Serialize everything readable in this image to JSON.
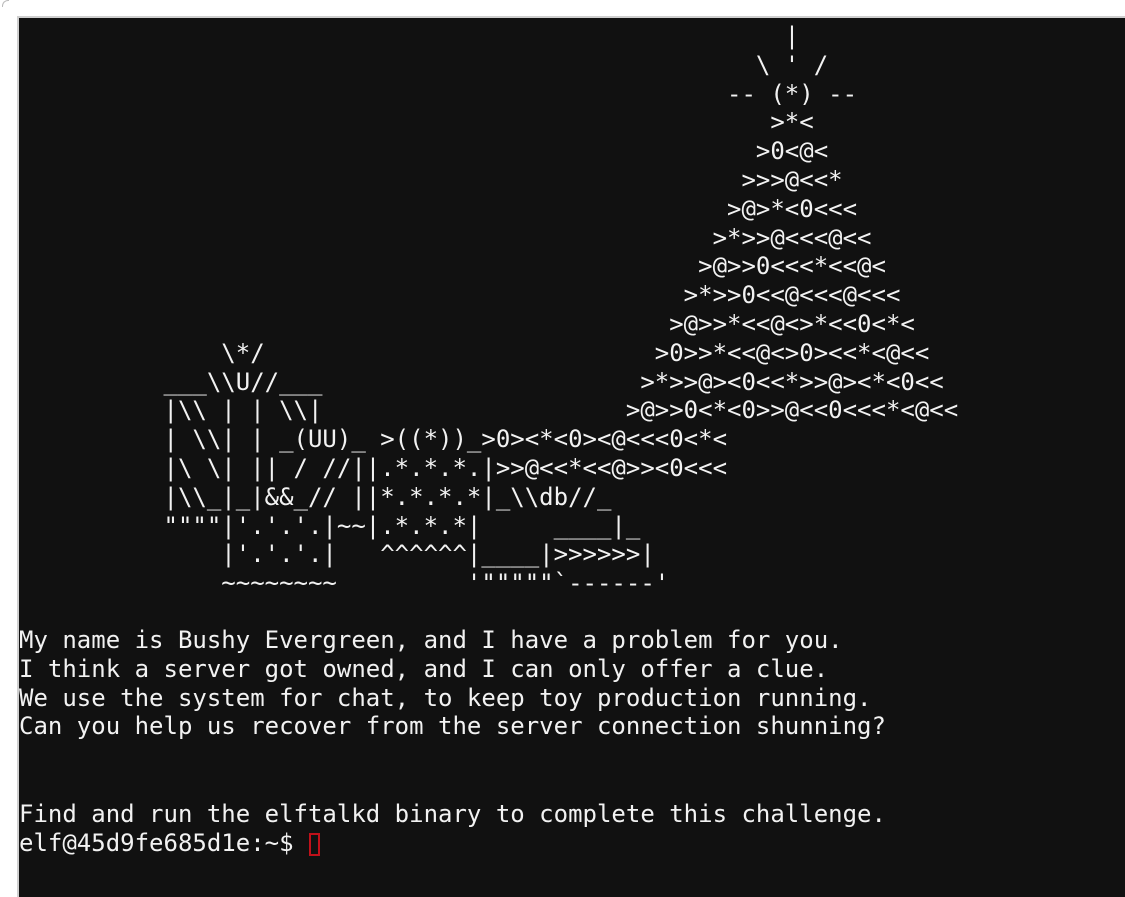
{
  "terminal": {
    "ascii_art": "                                                     |\n                                                   \\ ' /\n                                                 -- (*) --\n                                                    >*<\n                                                   >0<@<\n                                                  >>>@<<*\n                                                 >@>*<0<<<\n                                                >*>>@<<<@<<\n                                               >@>>0<<<*<<@<\n                                              >*>>0<<@<<<@<<<\n                                             >@>>*<<@<>*<<0<*<\n              \\*/                           >0>>*<<@<>0><<*<@<<\n          ___\\\\U//___                      >*>>@><0<<*>>@><*<0<<\n          |\\\\ | | \\\\|                     >@>>0<*<0>>@<<0<<<*<@<<\n          | \\\\| | _(UU)_ >((*))_>0><*<0><@<<<0<*<\n          |\\ \\| || / //||.*.*.*.|>>@<<*<<@>><0<<<\n          |\\\\_|_|&&_// ||*.*.*.*|_\\\\db//_\n          \"\"\"\"|'.'.'.|~~|.*.*.*|     ____|_\n              |'.'.'.|   ^^^^^^|____|>>>>>>|\n              ~~~~~~~~         '\"\"\"\"\"`------'",
    "message_lines": [
      "My name is Bushy Evergreen, and I have a problem for you.",
      "I think a server got owned, and I can only offer a clue.",
      "We use the system for chat, to keep toy production running.",
      "Can you help us recover from the server connection shunning?"
    ],
    "instruction": "Find and run the elftalkd binary to complete this challenge.",
    "prompt": "elf@45d9fe685d1e:~$",
    "colors": {
      "background": "#111111",
      "foreground": "#f2f2f2",
      "cursor": "#c0111a"
    }
  }
}
